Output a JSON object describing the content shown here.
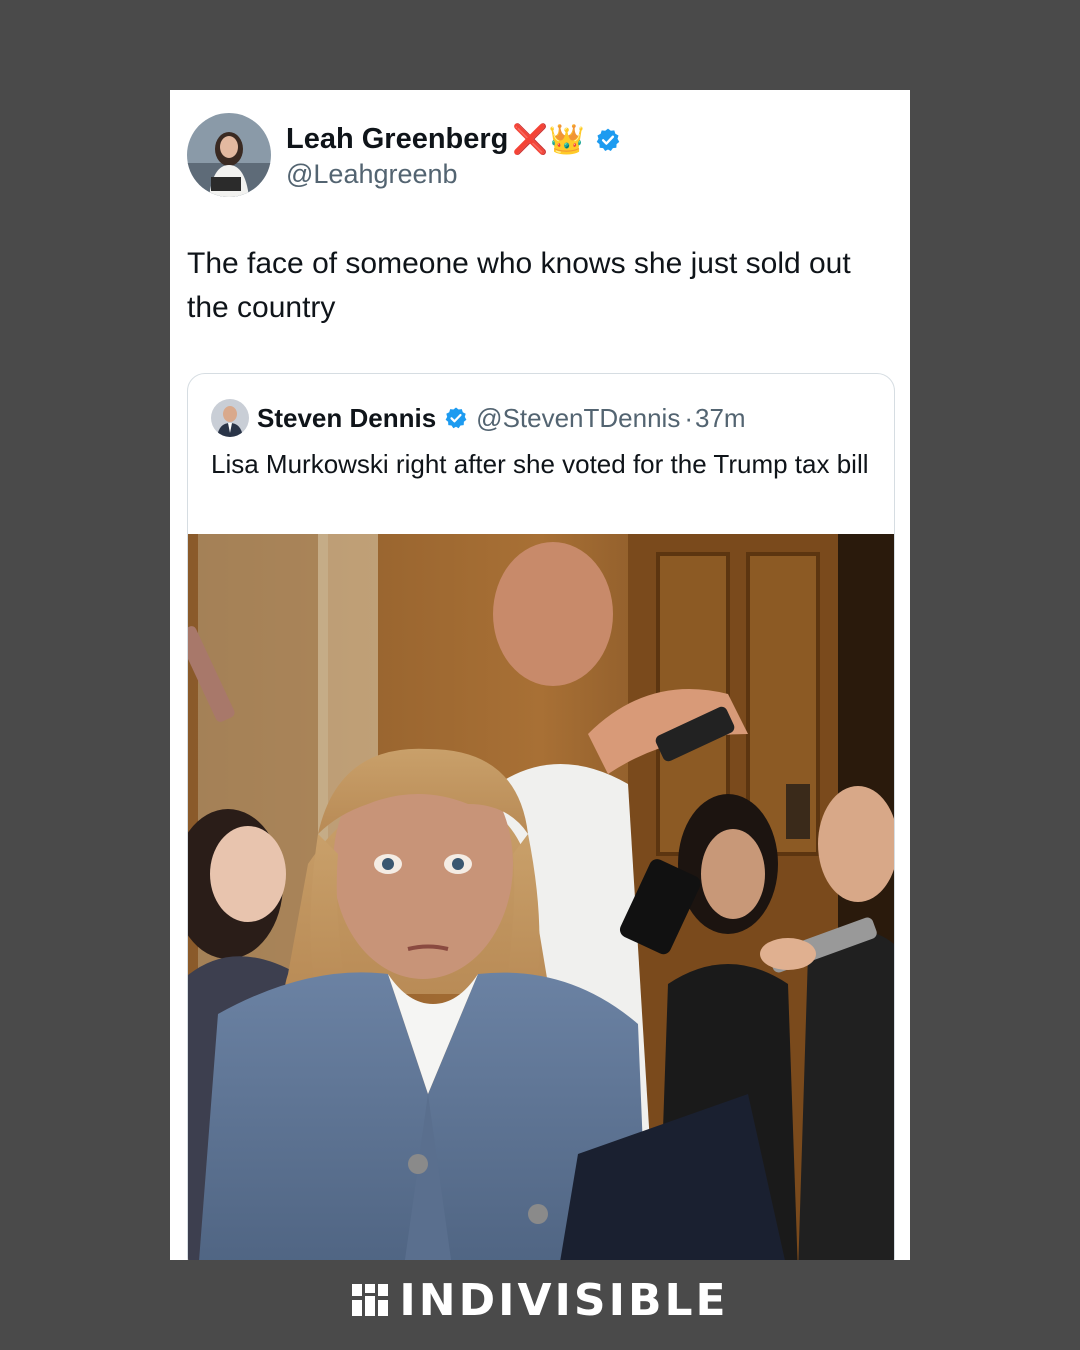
{
  "tweet": {
    "author_name": "Leah Greenberg",
    "author_emojis": "❌👑",
    "handle": "@Leahgreenb",
    "text": "The face of someone who knows she just sold out the country"
  },
  "quoted": {
    "author_name": "Steven Dennis",
    "handle": "@StevenTDennis",
    "separator": "·",
    "time": "37m",
    "text": "Lisa Murkowski right after she voted for the Trump tax bill"
  },
  "footer": {
    "brand": "INDIVISIBLE"
  },
  "colors": {
    "background": "#4a4a4a",
    "verified": "#1d9bf0",
    "text_primary": "#0f1419",
    "text_secondary": "#536471"
  },
  "icons": {
    "verified": "verified-badge-icon",
    "brand_logo": "indivisible-logo-icon"
  }
}
